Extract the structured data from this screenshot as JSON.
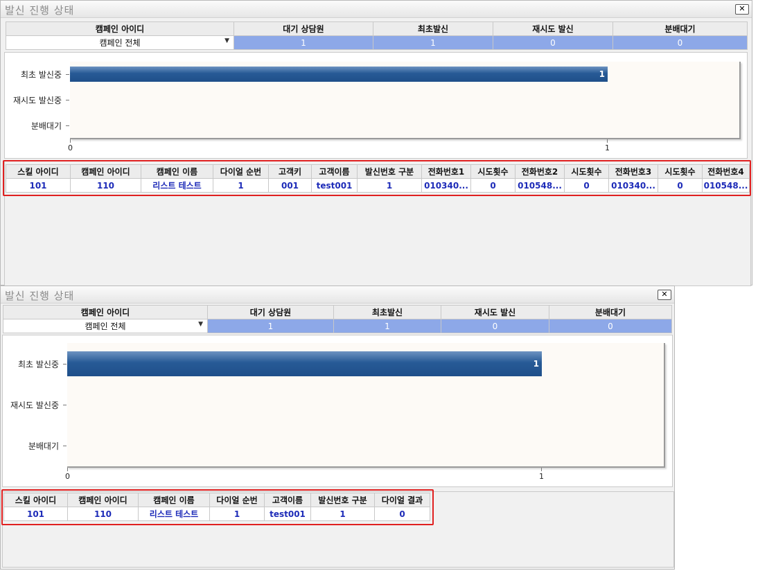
{
  "window1": {
    "title": "발신 진행 상태",
    "close_icon": "close-icon",
    "summary": {
      "headers": [
        "캠페인 아이디",
        "대기 상담원",
        "최초발신",
        "재시도 발신",
        "분배대기"
      ],
      "campaign_select": "캠페인 전체",
      "values": [
        "1",
        "1",
        "0",
        "0"
      ]
    },
    "chart_data": {
      "type": "bar",
      "orientation": "horizontal",
      "categories": [
        "최초 발신중",
        "재시도 발신중",
        "분배대기"
      ],
      "values": [
        1,
        0,
        0
      ],
      "data_labels": [
        "1",
        "",
        ""
      ],
      "xlim": [
        0,
        1
      ],
      "xticks": [
        "0",
        "1"
      ],
      "bar_color": "#275a96"
    },
    "detail": {
      "headers": [
        "스킬 아이디",
        "캠페인 아이디",
        "캠페인 이름",
        "다이얼 순번",
        "고객키",
        "고객이름",
        "발신번호 구분",
        "전화번호1",
        "시도횟수",
        "전화번호2",
        "시도횟수",
        "전화번호3",
        "시도횟수",
        "전화번호4"
      ],
      "rows": [
        [
          "101",
          "110",
          "리스트 테스트",
          "1",
          "001",
          "test001",
          "1",
          "010340...",
          "0",
          "010548...",
          "0",
          "010340...",
          "0",
          "010548..."
        ]
      ]
    }
  },
  "window2": {
    "title": "발신 진행 상태",
    "close_icon": "close-icon",
    "summary": {
      "headers": [
        "캠페인 아이디",
        "대기 상담원",
        "최초발신",
        "재시도 발신",
        "분배대기"
      ],
      "campaign_select": "캠페인 전체",
      "values": [
        "1",
        "1",
        "0",
        "0"
      ]
    },
    "chart_data": {
      "type": "bar",
      "orientation": "horizontal",
      "categories": [
        "최초 발신중",
        "재시도 발신중",
        "분배대기"
      ],
      "values": [
        1,
        0,
        0
      ],
      "data_labels": [
        "1",
        "",
        ""
      ],
      "xlim": [
        0,
        1
      ],
      "xticks": [
        "0",
        "1"
      ],
      "bar_color": "#275a96"
    },
    "detail": {
      "headers": [
        "스킬 아이디",
        "캠페인 아이디",
        "캠페인 이름",
        "다이얼 순번",
        "고객이름",
        "발신번호 구분",
        "다이얼 결과"
      ],
      "rows": [
        [
          "101",
          "110",
          "리스트 테스트",
          "1",
          "test001",
          "1",
          "0"
        ]
      ]
    }
  },
  "colors": {
    "highlight_border": "#e02020",
    "summary_value_bg": "#8da8e8",
    "detail_text": "#1d2bb8"
  }
}
